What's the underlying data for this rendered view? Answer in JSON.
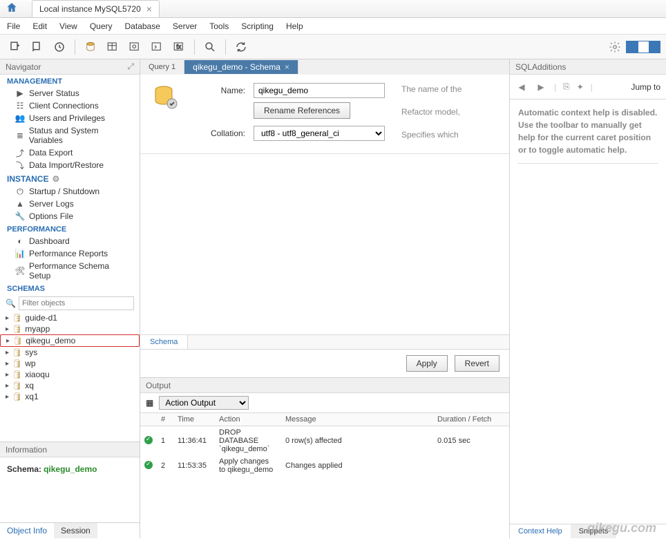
{
  "window": {
    "title": "Local instance MySQL5720"
  },
  "menu": [
    "File",
    "Edit",
    "View",
    "Query",
    "Database",
    "Server",
    "Tools",
    "Scripting",
    "Help"
  ],
  "navigator": {
    "title": "Navigator",
    "sections": {
      "management": {
        "title": "MANAGEMENT",
        "items": [
          "Server Status",
          "Client Connections",
          "Users and Privileges",
          "Status and System Variables",
          "Data Export",
          "Data Import/Restore"
        ]
      },
      "instance": {
        "title": "INSTANCE",
        "items": [
          "Startup / Shutdown",
          "Server Logs",
          "Options File"
        ]
      },
      "performance": {
        "title": "PERFORMANCE",
        "items": [
          "Dashboard",
          "Performance Reports",
          "Performance Schema Setup"
        ]
      },
      "schemas": {
        "title": "SCHEMAS",
        "filter_placeholder": "Filter objects",
        "items": [
          "guide-d1",
          "myapp",
          "qikegu_demo",
          "sys",
          "wp",
          "xiaoqu",
          "xq",
          "xq1"
        ],
        "highlighted": "qikegu_demo"
      }
    },
    "bottom_tabs": [
      "Object Info",
      "Session"
    ]
  },
  "information": {
    "title": "Information",
    "label": "Schema:",
    "schema": "qikegu_demo"
  },
  "editor": {
    "tabs": [
      {
        "label": "Query 1"
      },
      {
        "label": "qikegu_demo - Schema",
        "active": true
      }
    ],
    "form": {
      "name_label": "Name:",
      "name_value": "qikegu_demo",
      "rename_btn": "Rename References",
      "collation_label": "Collation:",
      "collation_value": "utf8 - utf8_general_ci",
      "hints": [
        "The name of the",
        "Refactor model,",
        "Specifies which"
      ]
    },
    "bottom_tab": "Schema",
    "apply": "Apply",
    "revert": "Revert"
  },
  "output": {
    "title": "Output",
    "selector": "Action Output",
    "columns": [
      "",
      "#",
      "Time",
      "Action",
      "Message",
      "Duration / Fetch"
    ],
    "rows": [
      {
        "status": "ok",
        "num": "1",
        "time": "11:36:41",
        "action": "DROP DATABASE `qikegu_demo`",
        "message": "0 row(s) affected",
        "duration": "0.015 sec"
      },
      {
        "status": "ok",
        "num": "2",
        "time": "11:53:35",
        "action": "Apply changes to qikegu_demo",
        "message": "Changes applied",
        "duration": ""
      }
    ]
  },
  "sqladditions": {
    "title": "SQLAdditions",
    "jump": "Jump to",
    "help": "Automatic context help is disabled. Use the toolbar to manually get help for the current caret position or to toggle automatic help.",
    "tabs": [
      "Context Help",
      "Snippets"
    ]
  },
  "watermark": "qikegu.com"
}
